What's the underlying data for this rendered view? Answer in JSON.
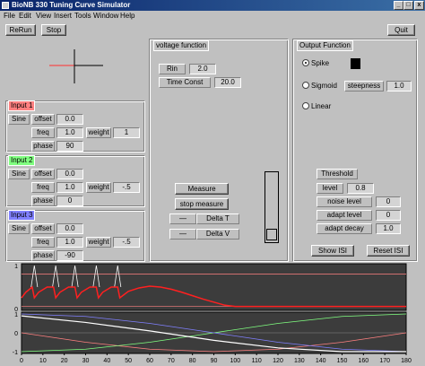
{
  "window": {
    "title": "BioNB 330 Tuning Curve Simulator",
    "minimize": "_",
    "maximize": "□",
    "close": "x"
  },
  "menu": [
    "File",
    "Edit",
    "View",
    "Insert",
    "Tools",
    "Window",
    "Help"
  ],
  "toolbar": {
    "rerun": "ReRun",
    "stop": "Stop",
    "quit": "Quit"
  },
  "inputs": [
    {
      "title": "Input 1",
      "color": "#ff8080",
      "wave": "Sine",
      "offset_label": "offset",
      "offset": "0.0",
      "freq_label": "freq",
      "freq": "1.0",
      "weight_label": "weight",
      "weight": "1",
      "phase_label": "phase",
      "phase": "90"
    },
    {
      "title": "Input 2",
      "color": "#80ff80",
      "wave": "Sine",
      "offset_label": "offset",
      "offset": "0.0",
      "freq_label": "freq",
      "freq": "1.0",
      "weight_label": "weight",
      "weight": "-.5",
      "phase_label": "phase",
      "phase": "0"
    },
    {
      "title": "Input 3",
      "color": "#8080ff",
      "wave": "Sine",
      "offset_label": "offset",
      "offset": "0.0",
      "freq_label": "freq",
      "freq": "1.0",
      "weight_label": "weight",
      "weight": "-.5",
      "phase_label": "phase",
      "phase": "-90"
    }
  ],
  "voltage": {
    "title": "voltage function",
    "rin_label": "Rin",
    "rin": "2.0",
    "tc_label": "Time Const",
    "tc": "20.0",
    "measure": "Measure",
    "stop_measure": "stop measure",
    "dash1": "—",
    "delta_t": "Delta T",
    "dash2": "—",
    "delta_v": "Delta V"
  },
  "output": {
    "title": "Output Function",
    "spike": "Spike",
    "sigmoid": "Sigmoid",
    "linear": "Linear",
    "selected": "Spike",
    "steepness_label": "steepness",
    "steepness": "1.0",
    "threshold_label": "Threshold",
    "level_label": "level",
    "level": "0.8",
    "noise_label": "noise level",
    "noise": "0",
    "adapt_level_label": "adapt level",
    "adapt_level": "0",
    "adapt_decay_label": "adapt decay",
    "adapt_decay": "1.0",
    "show_isi": "Show ISI",
    "reset_isi": "Reset ISI"
  },
  "plot": {
    "upper_y_ticks": [
      "1",
      "0"
    ],
    "lower_y_ticks": [
      "1",
      "0",
      "-1"
    ],
    "x_ticks": [
      "0",
      "10",
      "20",
      "30",
      "40",
      "50",
      "60",
      "70",
      "80",
      "90",
      "100",
      "110",
      "120",
      "130",
      "140",
      "150",
      "160",
      "170",
      "180"
    ],
    "colors": {
      "membrane": "#ff2020",
      "spike": "#ffffff",
      "input1": "#ff8080",
      "input2": "#80ff80",
      "input3": "#8080ff",
      "sum": "#ffffff"
    }
  },
  "chart_data": {
    "type": "line",
    "xlim": [
      0,
      180
    ],
    "upper": {
      "ylim": [
        0,
        1
      ],
      "spike_times": [
        6,
        16,
        25,
        35,
        45
      ],
      "membrane": {
        "x": [
          0,
          2,
          5,
          6,
          8,
          12,
          15,
          16,
          18,
          22,
          25,
          26,
          28,
          32,
          35,
          36,
          38,
          42,
          45,
          46,
          50,
          55,
          60,
          65,
          70,
          75,
          80,
          85,
          90,
          95,
          100,
          180
        ],
        "y": [
          0.25,
          0.38,
          0.5,
          0.25,
          0.38,
          0.5,
          0.5,
          0.25,
          0.38,
          0.5,
          0.5,
          0.25,
          0.38,
          0.5,
          0.5,
          0.25,
          0.38,
          0.5,
          0.5,
          0.25,
          0.4,
          0.48,
          0.52,
          0.5,
          0.45,
          0.38,
          0.3,
          0.22,
          0.15,
          0.08,
          0.05,
          0.05
        ]
      },
      "threshold": 0.8
    },
    "lower": {
      "ylim": [
        -1,
        1
      ],
      "series": [
        {
          "x": [
            0,
            30,
            60,
            90,
            120,
            150,
            180
          ],
          "y": [
            0,
            -0.5,
            -0.87,
            -1,
            -0.87,
            -0.5,
            0
          ]
        },
        {
          "x": [
            0,
            30,
            60,
            90,
            120,
            150,
            180
          ],
          "y": [
            -1,
            -0.87,
            -0.5,
            0,
            0.5,
            0.87,
            1
          ]
        },
        {
          "x": [
            0,
            30,
            60,
            90,
            120,
            150,
            180
          ],
          "y": [
            1,
            0.87,
            0.5,
            0,
            -0.5,
            -0.87,
            -1
          ]
        },
        {
          "x": [
            0,
            30,
            60,
            90,
            120,
            150,
            180
          ],
          "y": [
            0.9,
            0.55,
            0.1,
            -0.4,
            -0.8,
            -1,
            -1
          ]
        }
      ]
    }
  }
}
